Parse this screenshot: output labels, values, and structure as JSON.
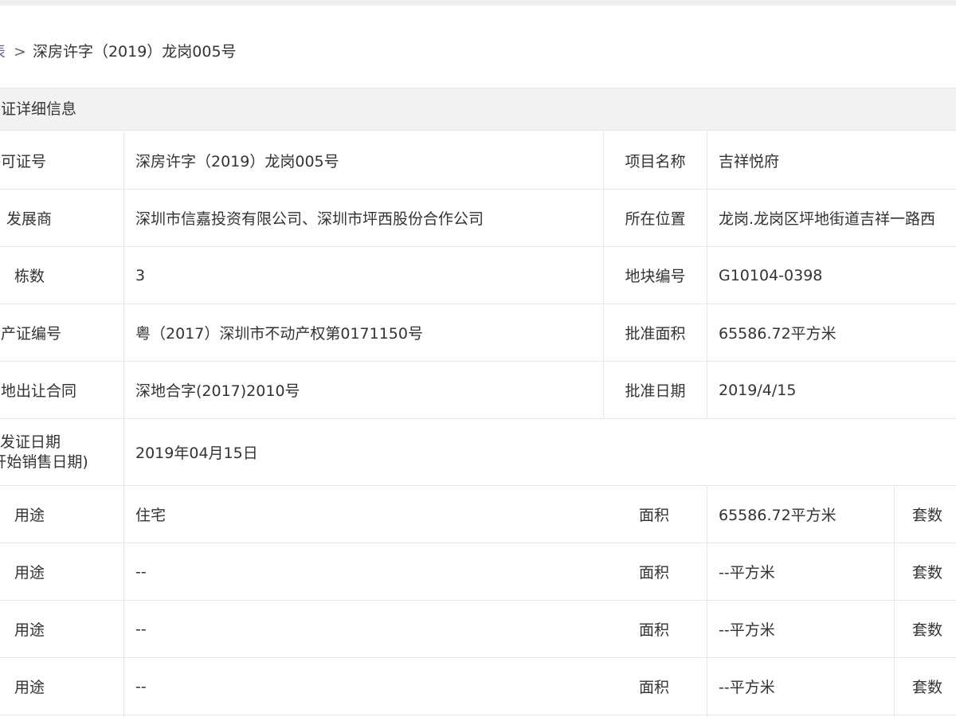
{
  "breadcrumb": {
    "link_fragment": "表",
    "separator": ">",
    "current": "深房许字（2019）龙岗005号"
  },
  "section": {
    "title": "可证详细信息"
  },
  "details": {
    "row1": {
      "label": "许可证号",
      "value": "深房许字（2019）龙岗005号",
      "label2": "项目名称",
      "value2": "吉祥悦府"
    },
    "row2": {
      "label": "发展商",
      "value": "深圳市信嘉投资有限公司、深圳市坪西股份合作公司",
      "label2": "所在位置",
      "value2": "龙岗.龙岗区坪地街道吉祥一路西"
    },
    "row3": {
      "label": "栋数",
      "value": "3",
      "label2": "地块编号",
      "value2": "G10104-0398"
    },
    "row4": {
      "label": "房产证编号",
      "value": "粤（2017）深圳市不动产权第0171150号",
      "label2": "批准面积",
      "value2": "65586.72平方米"
    },
    "row5": {
      "label": "土地出让合同",
      "value": "深地合字(2017)2010号",
      "label2": "批准日期",
      "value2": "2019/4/15"
    },
    "row6": {
      "label_line1": "发证日期",
      "label_line2": "(开始销售日期)",
      "value": "2019年04月15日"
    }
  },
  "usage_rows": [
    {
      "label": "用途",
      "value": "住宅",
      "area_label": "面积",
      "area_value": "65586.72平方米",
      "units_label": "套数"
    },
    {
      "label": "用途",
      "value": "--",
      "area_label": "面积",
      "area_value": "--平方米",
      "units_label": "套数"
    },
    {
      "label": "用途",
      "value": "--",
      "area_label": "面积",
      "area_value": "--平方米",
      "units_label": "套数"
    },
    {
      "label": "用途",
      "value": "--",
      "area_label": "面积",
      "area_value": "--平方米",
      "units_label": "套数"
    }
  ]
}
